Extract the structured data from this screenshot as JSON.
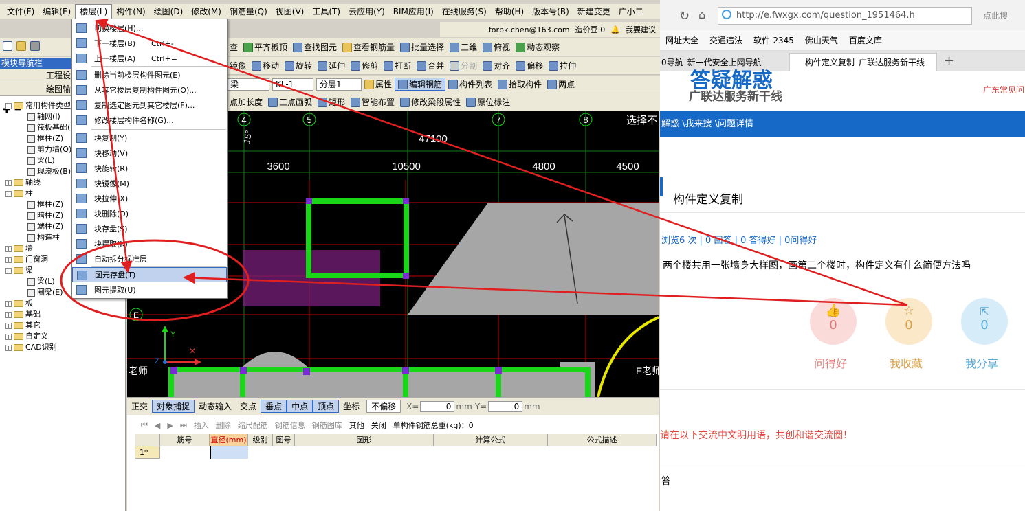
{
  "menubar": [
    "文件(F)",
    "编辑(E)",
    "楼层(L)",
    "构件(N)",
    "绘图(D)",
    "修改(M)",
    "钢筋量(Q)",
    "视图(V)",
    "工具(T)",
    "云应用(Y)",
    "BIM应用(I)",
    "在线服务(S)",
    "帮助(H)",
    "版本号(B)",
    "新建变更",
    "广小二"
  ],
  "account": {
    "email": "forpk.chen@163.com",
    "price": "造价豆:0",
    "suggest": "我要建议"
  },
  "toolbar1": [
    "查",
    "平齐板顶",
    "查找图元",
    "查看钢筋量",
    "批量选择",
    "三维",
    "俯视",
    "动态观察"
  ],
  "toolbar2": [
    "镜像",
    "移动",
    "旋转",
    "延伸",
    "修剪",
    "打断",
    "合并",
    "分割",
    "对齐",
    "偏移",
    "拉伸"
  ],
  "toolbar3": {
    "item1": "梁",
    "item2": "KL-1",
    "item3": "分层1",
    "attr": "属性",
    "edit_rebar": "编辑钢筋",
    "list": "构件列表",
    "pick": "拾取构件",
    "two_point": "两点"
  },
  "toolbar4": [
    "点加长度",
    "三点画弧",
    "矩形",
    "智能布置",
    "修改梁段属性",
    "原位标注"
  ],
  "left": {
    "header": "模块导航栏",
    "tab1": "工程设置",
    "tab2": "绘图输入"
  },
  "tree": [
    {
      "t": "常用构件类型",
      "lvl": 0,
      "open": true
    },
    {
      "t": "轴网(J)",
      "lvl": 1
    },
    {
      "t": "筏板基础(M)",
      "lvl": 1
    },
    {
      "t": "框柱(Z)",
      "lvl": 1
    },
    {
      "t": "剪力墙(Q)",
      "lvl": 1
    },
    {
      "t": "梁(L)",
      "lvl": 1
    },
    {
      "t": "现浇板(B)",
      "lvl": 1
    },
    {
      "t": "轴线",
      "lvl": 0
    },
    {
      "t": "柱",
      "lvl": 0,
      "open": true
    },
    {
      "t": "框柱(Z)",
      "lvl": 1
    },
    {
      "t": "暗柱(Z)",
      "lvl": 1
    },
    {
      "t": "端柱(Z)",
      "lvl": 1
    },
    {
      "t": "构造柱",
      "lvl": 1
    },
    {
      "t": "墙",
      "lvl": 0
    },
    {
      "t": "门窗洞",
      "lvl": 0
    },
    {
      "t": "梁",
      "lvl": 0,
      "open": true
    },
    {
      "t": "梁(L)",
      "lvl": 1
    },
    {
      "t": "圈梁(E)",
      "lvl": 1
    },
    {
      "t": "板",
      "lvl": 0
    },
    {
      "t": "基础",
      "lvl": 0
    },
    {
      "t": "其它",
      "lvl": 0
    },
    {
      "t": "自定义",
      "lvl": 0
    },
    {
      "t": "CAD识别",
      "lvl": 0
    }
  ],
  "dropdown": [
    {
      "label": "切换楼层(H)...",
      "sc": ""
    },
    {
      "label": "下一楼层(B)",
      "sc": "Ctrl+-"
    },
    {
      "label": "上一楼层(A)",
      "sc": "Ctrl+="
    },
    {
      "label": "删除当前楼层构件图元(E)",
      "sc": ""
    },
    {
      "label": "从其它楼层复制构件图元(O)...",
      "sc": ""
    },
    {
      "label": "复制选定图元到其它楼层(F)...",
      "sc": ""
    },
    {
      "label": "修改楼层构件名称(G)...",
      "sc": ""
    },
    {
      "label": "块复制(Y)",
      "sc": ""
    },
    {
      "label": "块移动(V)",
      "sc": ""
    },
    {
      "label": "块旋转(R)",
      "sc": ""
    },
    {
      "label": "块镜像(M)",
      "sc": ""
    },
    {
      "label": "块拉伸(X)",
      "sc": ""
    },
    {
      "label": "块删除(D)",
      "sc": ""
    },
    {
      "label": "块存盘(S)",
      "sc": ""
    },
    {
      "label": "块提取(K)",
      "sc": ""
    },
    {
      "label": "自动拆分标准层",
      "sc": ""
    },
    {
      "label": "图元存盘(T)",
      "sc": ""
    },
    {
      "label": "图元提取(U)",
      "sc": ""
    }
  ],
  "canvas": {
    "axes": [
      "4",
      "5",
      "7",
      "8"
    ],
    "total": "47100",
    "spans": [
      "3600",
      "10500",
      "4800",
      "4500"
    ],
    "angle": "15°",
    "select": "选择不",
    "left_label": "老师",
    "right_label": "E老师",
    "grid_label": "E"
  },
  "status": [
    "正交",
    "对象捕捉",
    "动态输入",
    "交点",
    "垂点",
    "中点",
    "顶点",
    "坐标",
    "不偏移"
  ],
  "coord": {
    "x_label": "X=",
    "x": "0",
    "y_label": "Y=",
    "y": "0",
    "unit": "mm"
  },
  "bottom_bar": [
    "插入",
    "删除",
    "缩尺配筋",
    "钢筋信息",
    "钢筋图库",
    "其他",
    "关闭",
    "单构件钢筋总重(kg)：0"
  ],
  "grid_cols": [
    "筋号",
    "直径(mm)",
    "级别",
    "图号",
    "图形",
    "计算公式",
    "公式描述"
  ],
  "grid_row1": "1*",
  "browser": {
    "url": "http://e.fwxgx.com/question_1951464.h",
    "search": "点此搜",
    "bookmarks": [
      "网址大全",
      "交通违法",
      "软件-2345",
      "佛山天气",
      "百度文库"
    ],
    "tab1": "0导航_新一代安全上网导航",
    "tab2": "构件定义复制_广联达服务新干线",
    "logo_line1": "答疑解惑",
    "logo_line2": "广联达服务新干线",
    "top_right": "广东常见问",
    "crumb": "解惑 \\我来搜 \\问题详情",
    "title": "构件定义复制",
    "stats": "浏览6 次 | 0 回答 | 0 答得好 | 0问得好",
    "question": "两个楼共用一张墙身大样图，画第二个楼时，构件定义有什么简便方法吗",
    "btns": [
      {
        "label": "问得好",
        "count": "0"
      },
      {
        "label": "我收藏",
        "count": "0"
      },
      {
        "label": "我分享",
        "count": "0"
      }
    ],
    "notice": "请在以下交流中文明用语，共创和谐交流圈！",
    "answer": "答"
  }
}
